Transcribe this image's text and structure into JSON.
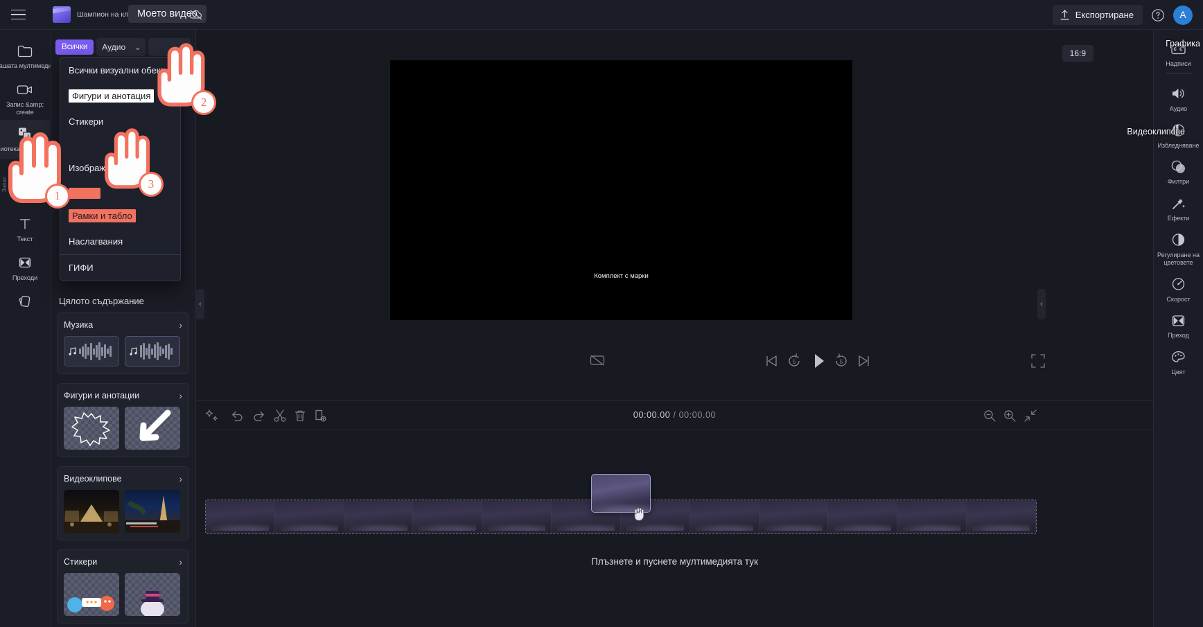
{
  "header": {
    "menu_icon": "hamburger-menu-icon",
    "logo_icon": "clipchamp-logo-icon",
    "template_name": "Шампион на клиповете",
    "project_title": "Моето видео",
    "cloud_icon": "cloud-offline-icon",
    "export_label": "Експортиране",
    "export_icon": "upload-arrow-icon",
    "help_icon": "help-circle-icon",
    "avatar_initial": "A"
  },
  "left_rail": {
    "items": [
      {
        "label": "Вашата мултимедия",
        "icon": "folder-icon",
        "active": false
      },
      {
        "label": "Запис &amp; create",
        "icon": "video-camera-icon",
        "active": true
      },
      {
        "label": "Библиотека на библиотека",
        "icon": "media-library-icon",
        "active": false
      },
      {
        "label": "",
        "icon": "music-note-icon",
        "active": false
      },
      {
        "label": "Текст",
        "icon": "text-t-icon",
        "active": false
      },
      {
        "label": "Преходи",
        "icon": "transition-icon",
        "active": false
      },
      {
        "label": "",
        "icon": "layers-icon",
        "active": false
      }
    ],
    "vertical_note": "Запис"
  },
  "content_panel": {
    "filter_all_label": "Всички",
    "audio_select_value": "Аудио",
    "visual_select_value": "",
    "dropdown": {
      "items": [
        {
          "label": "Всички визуални обекти",
          "style": "plain"
        },
        {
          "label": "Фигури и анотация",
          "style": "highlight-white"
        },
        {
          "label": "Стикери",
          "style": "plain"
        },
        {
          "label": "",
          "style": "blank"
        },
        {
          "label": "Изображения",
          "style": "plain"
        },
        {
          "label": "",
          "style": "swatch"
        },
        {
          "label": "Рамки и табло",
          "style": "highlight-salmon"
        },
        {
          "label": "Наслагвания",
          "style": "plain"
        },
        {
          "label": "ГИФИ",
          "style": "plain"
        }
      ]
    },
    "all_content_title": "Цялото съдържание",
    "sections": [
      {
        "title": "Музика",
        "chevron": "chevron-right-icon",
        "kind": "audio"
      },
      {
        "title": "Фигури и анотации",
        "chevron": "chevron-right-icon",
        "kind": "shapes"
      },
      {
        "title": "Видеоклипове",
        "chevron": "chevron-right-icon",
        "kind": "video"
      },
      {
        "title": "Стикери",
        "chevron": "chevron-right-icon",
        "kind": "stickers"
      }
    ]
  },
  "preview": {
    "aspect_ratio": "16:9",
    "stage_caption": "Комплект с марки",
    "controls": [
      {
        "name": "captions-toggle",
        "icon": "captions-off-icon"
      },
      {
        "name": "skip-to-start",
        "icon": "skip-start-icon"
      },
      {
        "name": "back-5s",
        "icon": "rewind-5-icon"
      },
      {
        "name": "play",
        "icon": "play-icon"
      },
      {
        "name": "forward-5s",
        "icon": "forward-5-icon"
      },
      {
        "name": "skip-to-end",
        "icon": "skip-end-icon"
      },
      {
        "name": "fullscreen",
        "icon": "fullscreen-icon"
      }
    ]
  },
  "timeline": {
    "tools": [
      {
        "name": "magic-tools",
        "icon": "sparkle-icon"
      },
      {
        "name": "undo",
        "icon": "undo-arrow-icon"
      },
      {
        "name": "redo",
        "icon": "redo-arrow-icon"
      },
      {
        "name": "split",
        "icon": "scissors-icon"
      },
      {
        "name": "delete",
        "icon": "trash-icon"
      },
      {
        "name": "duplicate",
        "icon": "duplicate-icon"
      }
    ],
    "current_time": "00:00.00",
    "separator": "/",
    "total_time": "00:00.00",
    "zoom_tools": [
      {
        "name": "zoom-out",
        "icon": "magnifier-minus-icon"
      },
      {
        "name": "zoom-in",
        "icon": "magnifier-plus-icon"
      },
      {
        "name": "fit-to-screen",
        "icon": "fit-arrows-icon"
      }
    ],
    "drop_hint": "Плъзнете и пуснете мултимедията тук"
  },
  "right_rail": {
    "items": [
      {
        "label": "Надписи",
        "icon": "captions-icon"
      },
      {
        "label": "Аудио",
        "icon": "speaker-icon"
      },
      {
        "label": "Избледняване",
        "icon": "fade-icon"
      },
      {
        "label": "Филтри",
        "icon": "filters-circles-icon"
      },
      {
        "label": "Ефекти",
        "icon": "magic-wand-icon"
      },
      {
        "label": "Регулиране на цветовете",
        "icon": "contrast-icon"
      },
      {
        "label": "Скорост",
        "icon": "speedometer-icon"
      },
      {
        "label": "Преход",
        "icon": "transition-icon"
      },
      {
        "label": "Цвят",
        "icon": "palette-icon"
      }
    ]
  },
  "overlay_labels": {
    "grafika": "Графика",
    "videoklipove": "Видеоклипове"
  },
  "annotations": {
    "badges": [
      "1",
      "2",
      "3"
    ],
    "hand_icon": "pointing-hand-icon",
    "grab_icon": "grabbing-hand-icon"
  },
  "colors": {
    "accent_purple": "#7a5cf0",
    "annotation_salmon": "#f2725f",
    "panel_bg": "#1b1d26",
    "app_bg": "#15161d",
    "avatar_blue": "#2c7fd4"
  }
}
